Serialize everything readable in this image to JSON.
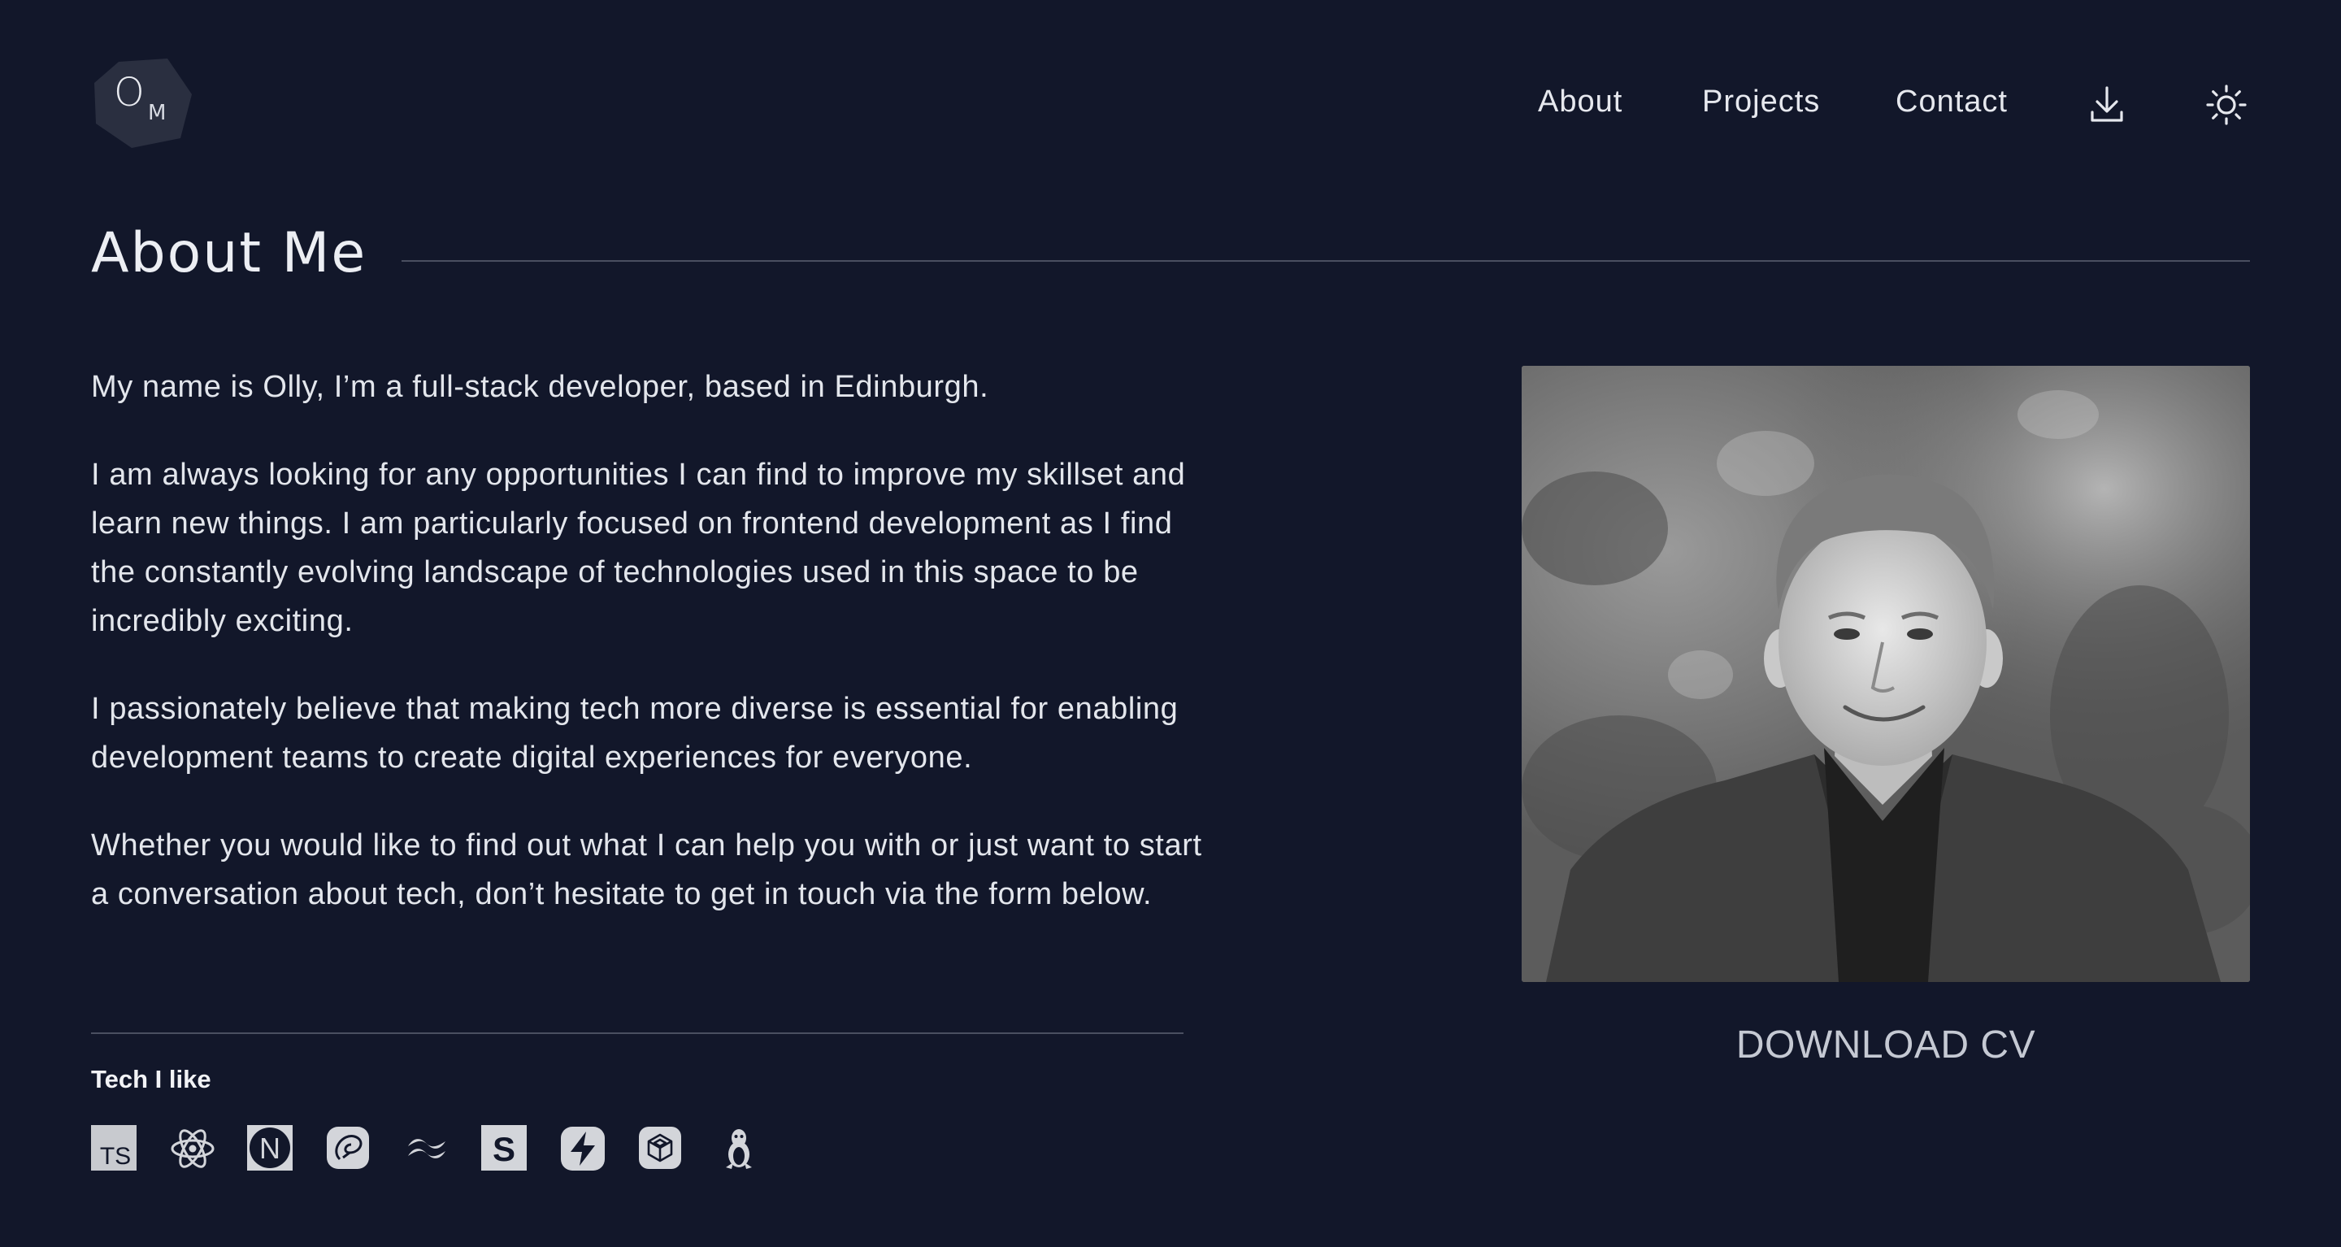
{
  "logo": {
    "big_letter": "O",
    "small_letter": "M"
  },
  "nav": {
    "about": "About",
    "projects": "Projects",
    "contact": "Contact",
    "download_icon": "download-icon",
    "theme_icon": "sun-icon"
  },
  "about": {
    "title": "About Me",
    "paragraphs": [
      "My name is Olly, I’m a full-stack developer, based in Edinburgh.",
      "I am always looking for any opportunities I can find to improve my skillset and learn new things. I am particularly focused on frontend development as I find the constantly evolving landscape of technologies used in this space to be incredibly exciting.",
      "I passionately believe that making tech more diverse is essential for enabling development teams to create digital experiences for everyone.",
      "Whether you would like to find out what I can help you with or just want to start a conversation about tech, don’t hesitate to get in touch via the form below."
    ]
  },
  "tech": {
    "title": "Tech I like",
    "icons": [
      "typescript-icon",
      "react-icon",
      "nextjs-icon",
      "sequelize-icon",
      "tailwind-icon",
      "storybook-icon",
      "supabase-icon",
      "codesandbox-icon",
      "linux-icon"
    ],
    "ts_label": "TS",
    "n_label": "N",
    "s_label": "S"
  },
  "photo": {
    "icon": "portrait-photo"
  },
  "cv": {
    "label": "DOWNLOAD CV"
  },
  "colors": {
    "background": "#12172a",
    "text": "#e6e8ee",
    "divider": "#4a4f60",
    "muted": "#c5c9d3"
  }
}
